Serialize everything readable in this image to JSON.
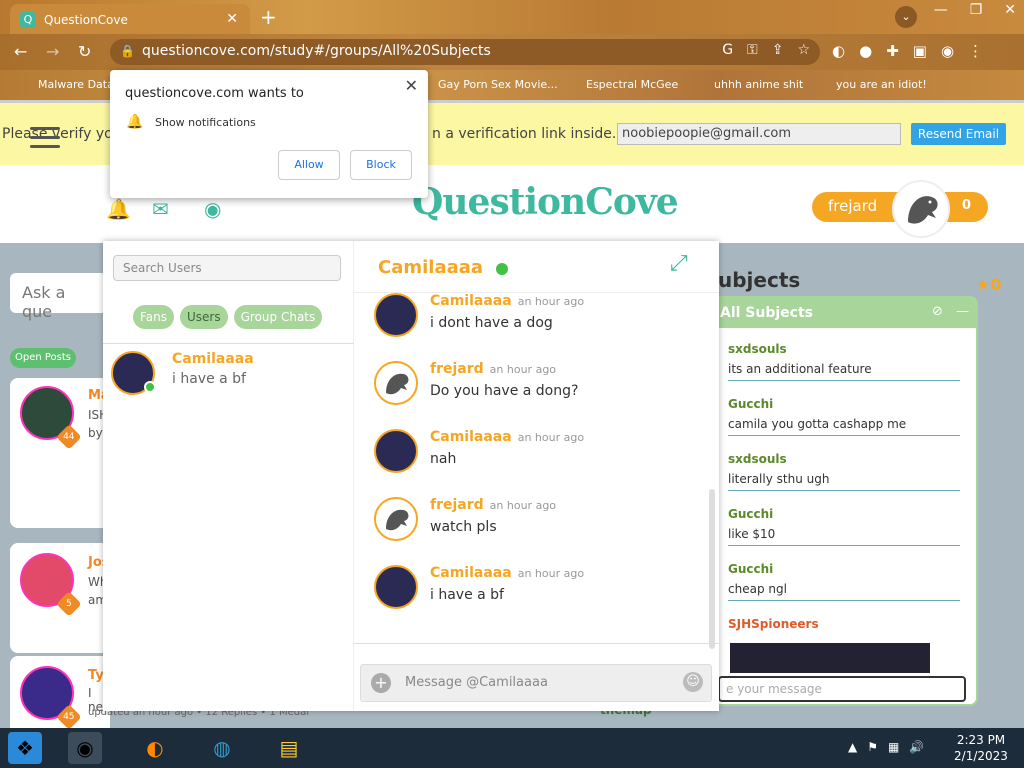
{
  "browser": {
    "tab_title": "QuestionCove",
    "tab_icon": "questioncove-favicon",
    "url": "questioncove.com/study#/groups/All%20Subjects",
    "bookmarks": [
      "Malware Data",
      "Gay Porn Sex Movie...",
      "Espectral McGee",
      "uhhh anime shit",
      "you are an idiot!"
    ]
  },
  "notification": {
    "title": "questioncove.com wants to",
    "permission": "Show notifications",
    "allow": "Allow",
    "block": "Block"
  },
  "verify_bar": {
    "text_left": "Please verify yo",
    "text_right": "n a verification link inside.",
    "email": "noobiepoopie@gmail.com",
    "resend": "Resend Email"
  },
  "header": {
    "logo": "QuestionCove",
    "username": "frejard",
    "points": "0"
  },
  "left": {
    "ask_placeholder": "Ask a que",
    "open_posts": "Open Posts",
    "posts": [
      {
        "name": "Ma",
        "text": "ISH",
        "sub": "by",
        "badge": "44"
      },
      {
        "name": "Jos",
        "text": "Wh",
        "sub": "am",
        "badge": "5"
      },
      {
        "name": "Ty",
        "text": "I ne",
        "sub": "",
        "badge": "45"
      }
    ],
    "footer": "updated an hour ago  •  12 Replies  •  1 Medal"
  },
  "dm": {
    "search_placeholder": "Search Users",
    "tabs": [
      "Fans",
      "Users",
      "Group Chats"
    ],
    "contact": {
      "name": "Camilaaaa",
      "preview": "i have a bf"
    },
    "chat_name": "Camilaaaa",
    "messages": [
      {
        "user": "Camilaaaa",
        "time": "an hour ago",
        "text": "i dont have a dog",
        "who": "cam"
      },
      {
        "user": "frejard",
        "time": "an hour ago",
        "text": "Do you have a dong?",
        "who": "fre"
      },
      {
        "user": "Camilaaaa",
        "time": "an hour ago",
        "text": "nah",
        "who": "cam"
      },
      {
        "user": "frejard",
        "time": "an hour ago",
        "text": "watch pls",
        "who": "fre"
      },
      {
        "user": "Camilaaaa",
        "time": "an hour ago",
        "text": "i have a bf",
        "who": "cam"
      }
    ],
    "input_placeholder": "Message @Camilaaaa"
  },
  "right": {
    "title": "ubjects",
    "medal_count": "0",
    "group_title": "All Subjects",
    "messages": [
      {
        "user": "sxdsouls",
        "text": "its an additional feature"
      },
      {
        "user": "Gucchi",
        "text": "camila you gotta cashapp me"
      },
      {
        "user": "sxdsouls",
        "text": "literally sthu ugh"
      },
      {
        "user": "Gucchi",
        "text": "like $10"
      },
      {
        "user": "Gucchi",
        "text": "cheap ngl"
      },
      {
        "user": "SJHSpioneers",
        "text": ""
      }
    ],
    "input_placeholder": "e your message",
    "partial_user": "themap"
  },
  "taskbar": {
    "time": "2:23 PM",
    "date": "2/1/2023"
  },
  "colors": {
    "accent": "#3fb8a0",
    "orange": "#f5a623",
    "green": "#a8d59a"
  }
}
